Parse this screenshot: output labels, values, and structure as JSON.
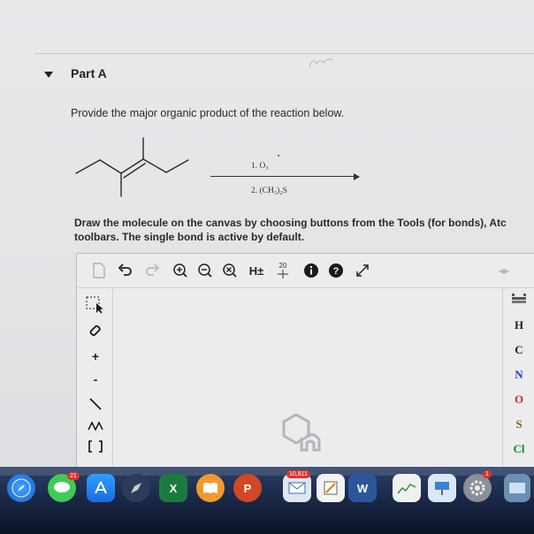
{
  "part": {
    "title": "Part A"
  },
  "question": {
    "text": "Provide the major organic product of the reaction below."
  },
  "reaction": {
    "reagent_1": "1. O₃",
    "reagent_2": "2. (CH₃)₂S"
  },
  "instructions": {
    "line1": "Draw the molecule on the canvas by choosing buttons from the Tools (for bonds), Atc",
    "line2": "toolbars. The single bond is active by default."
  },
  "toolbar": {
    "hydrogen_label": "H±",
    "template_label": "20"
  },
  "atoms": [
    "H",
    "C",
    "N",
    "O",
    "S",
    "Cl"
  ],
  "left_tools": {
    "charge_plus": "+",
    "charge_minus": "-"
  },
  "dock": {
    "messages_badge": "21",
    "mail_badge": "10,811",
    "calendar_badge": "1",
    "excel_label": "X",
    "powerpoint_label": "P",
    "word_label": "W"
  }
}
